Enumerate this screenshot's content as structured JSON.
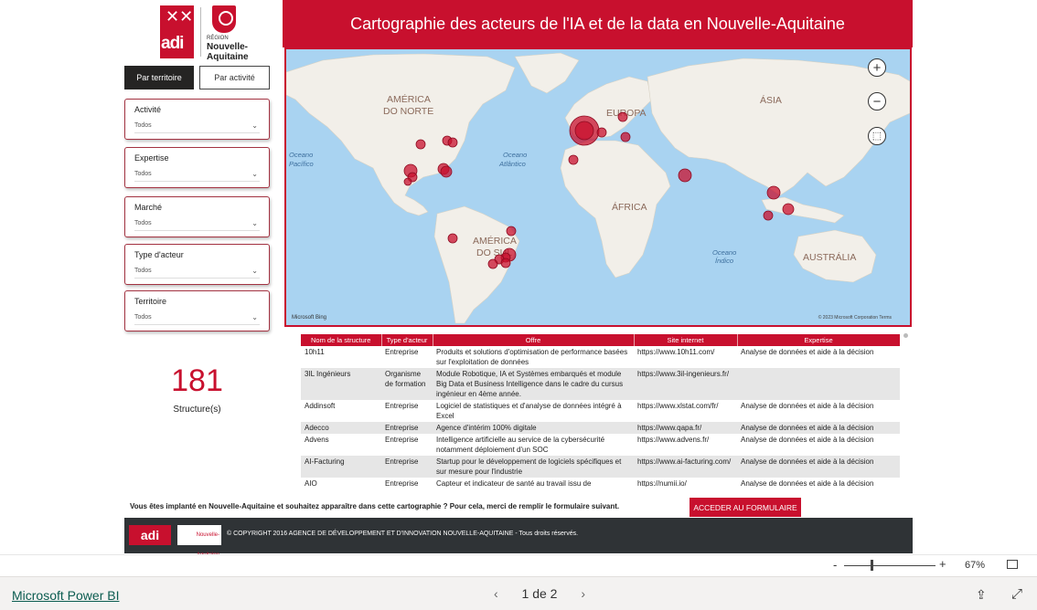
{
  "logos": {
    "adi_text": "adi",
    "region_small": "RÉGION",
    "region_line1": "Nouvelle-",
    "region_line2": "Aquitaine"
  },
  "tabs": [
    {
      "label": "Par territoire"
    },
    {
      "label": "Par activité"
    }
  ],
  "filters": [
    {
      "label": "Activité",
      "value": "Todos"
    },
    {
      "label": "Expertise",
      "value": "Todos"
    },
    {
      "label": "Marché",
      "value": "Todos"
    },
    {
      "label": "Type d'acteur",
      "value": "Todos"
    },
    {
      "label": "Territoire",
      "value": "Todos"
    }
  ],
  "title": "Cartographie des acteurs de l'IA et de la data en Nouvelle-Aquitaine",
  "map": {
    "labels": [
      {
        "text": "AMÉRICA"
      },
      {
        "text": "DO NORTE"
      },
      {
        "text": "EUROPA"
      },
      {
        "text": "ÁSIA"
      },
      {
        "text": "ÁFRICA"
      },
      {
        "text": "AMÉRICA"
      },
      {
        "text": "DO SUL"
      },
      {
        "text": "AUSTRÁLIA"
      },
      {
        "text": "Oceano"
      },
      {
        "text": "Atlântico"
      },
      {
        "text": "Oceano"
      },
      {
        "text": "Índico"
      },
      {
        "text": "Oceano"
      },
      {
        "text": "Pacífico"
      }
    ],
    "bing_label": "Microsoft Bing",
    "copyright": "© 2023 Microsoft Corporation  Terms",
    "controls": {
      "zoom_in": "+",
      "zoom_out": "−",
      "select": "⬚"
    },
    "marker_color": "#c8102e"
  },
  "kpi": {
    "value": "181",
    "label": "Structure(s)"
  },
  "table": {
    "columns": [
      "Nom de la structure",
      "Type d'acteur",
      "Offre",
      "Site internet",
      "Expertise"
    ],
    "rows": [
      [
        "10h11",
        "Entreprise",
        "Produits et solutions d'optimisation de performance basées sur l'exploitation de données",
        "https://www.10h11.com/",
        "Analyse de données et aide à la décision"
      ],
      [
        "3IL Ingénieurs",
        "Organisme de formation",
        "Module Robotique, IA et Systèmes embarqués et module Big Data et Business Intelligence dans le cadre du cursus ingénieur en 4ème année.",
        "https://www.3il-ingenieurs.fr/",
        ""
      ],
      [
        "Addinsoft",
        "Entreprise",
        "Logiciel de statistiques et d'analyse de données intégré à Excel",
        "https://www.xlstat.com/fr/",
        "Analyse de données et aide à la décision"
      ],
      [
        "Adecco",
        "Entreprise",
        "Agence d'intérim 100% digitale",
        "https://www.qapa.fr/",
        "Analyse de données et aide à la décision"
      ],
      [
        "Advens",
        "Entreprise",
        "Intelligence artificielle au service de la cybersécurité notamment déploiement d'un SOC",
        "https://www.advens.fr/",
        "Analyse de données et aide à la décision"
      ],
      [
        "AI-Facturing",
        "Entreprise",
        "Startup pour le développement de logiciels spécifiques et sur mesure pour l'industrie",
        "https://www.ai-facturing.com/",
        "Analyse de données et aide à la décision"
      ],
      [
        "AIO",
        "Entreprise",
        "Capteur et indicateur de santé au travail issu de",
        "https://numii.io/",
        "Analyse de données et aide à la décision"
      ]
    ]
  },
  "cta": {
    "text": "Vous êtes implanté en Nouvelle-Aquitaine et souhaitez apparaître dans cette cartographie ? Pour cela, merci de remplir le formulaire suivant.",
    "button": "ACCEDER AU FORMULAIRE"
  },
  "footer": {
    "adi": "adi",
    "region": "Nouvelle-Aquitaine",
    "text": "© COPYRIGHT 2016 AGENCE DE DÉVELOPPEMENT ET D'INNOVATION NOUVELLE-AQUITAINE - Tous droits réservés."
  },
  "zoom": {
    "minus": "-",
    "plus": "+",
    "value": "67%"
  },
  "bottom": {
    "brand": "Microsoft Power BI",
    "page": "1 de 2",
    "prev": "‹",
    "next": "›"
  }
}
